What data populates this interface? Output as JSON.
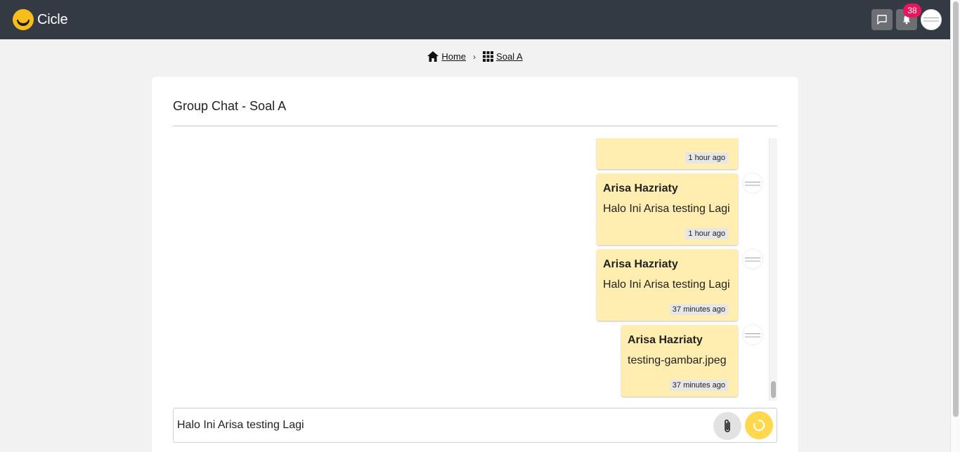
{
  "navbar": {
    "brand": "Cicle",
    "logo_icon": "smiley-logo-icon",
    "chat_icon": "message-square-icon",
    "bell_icon": "bell-icon",
    "notification_count": "38",
    "colors": {
      "background": "#343a44",
      "badge": "#e8175d"
    }
  },
  "breadcrumb": {
    "home_label": "Home",
    "home_icon": "home-icon",
    "separator": "›",
    "current_label": "Soal A",
    "current_icon": "grid-icon"
  },
  "chat": {
    "title": "Group Chat - Soal A",
    "messages": [
      {
        "author": "",
        "text": "",
        "time": "1 hour ago"
      },
      {
        "author": "Arisa Hazriaty",
        "text": "Halo Ini Arisa testing Lagi",
        "time": "1 hour ago"
      },
      {
        "author": "Arisa Hazriaty",
        "text": "Halo Ini Arisa testing Lagi",
        "time": "37 minutes ago"
      },
      {
        "author": "Arisa Hazriaty",
        "text": "testing-gambar.jpeg",
        "time": "37 minutes ago"
      }
    ],
    "bubble_color": "#ffeeb0"
  },
  "composer": {
    "value": "Halo Ini Arisa testing Lagi",
    "attach_icon": "paperclip-icon",
    "send_icon": "loading-spinner-icon",
    "send_color": "#ffd84d"
  }
}
